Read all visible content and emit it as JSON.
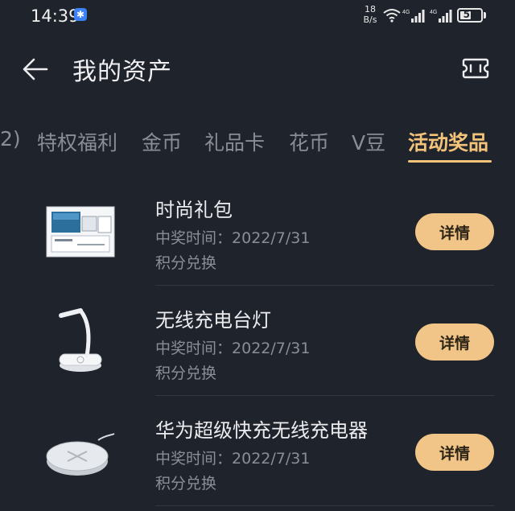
{
  "status_bar": {
    "time": "14:39",
    "net_speed_value": "18",
    "net_speed_unit": "B/s",
    "signal_label_1": "4G",
    "signal_label_2": "4G",
    "battery": "55",
    "battery_level": 0.55
  },
  "header": {
    "title": "我的资产"
  },
  "tabs": [
    {
      "label": "2)"
    },
    {
      "label": "特权福利"
    },
    {
      "label": "金币"
    },
    {
      "label": "礼品卡"
    },
    {
      "label": "花币"
    },
    {
      "label": "V豆"
    },
    {
      "label": "活动奖品",
      "active": true
    }
  ],
  "prizes": [
    {
      "name": "时尚礼包",
      "date_label": "中奖时间：",
      "date": "2022/7/31",
      "method": "积分兑换",
      "button": "详情",
      "icon": "gift-box-image"
    },
    {
      "name": "无线充电台灯",
      "date_label": "中奖时间：",
      "date": "2022/7/31",
      "method": "积分兑换",
      "button": "详情",
      "icon": "desk-lamp-image"
    },
    {
      "name": "华为超级快充无线充电器",
      "date_label": "中奖时间：",
      "date": "2022/7/31",
      "method": "积分兑换",
      "button": "详情",
      "icon": "wireless-charger-image"
    }
  ],
  "colors": {
    "background": "#1f232c",
    "accent": "#f3c37a",
    "button": "#f0c587"
  }
}
